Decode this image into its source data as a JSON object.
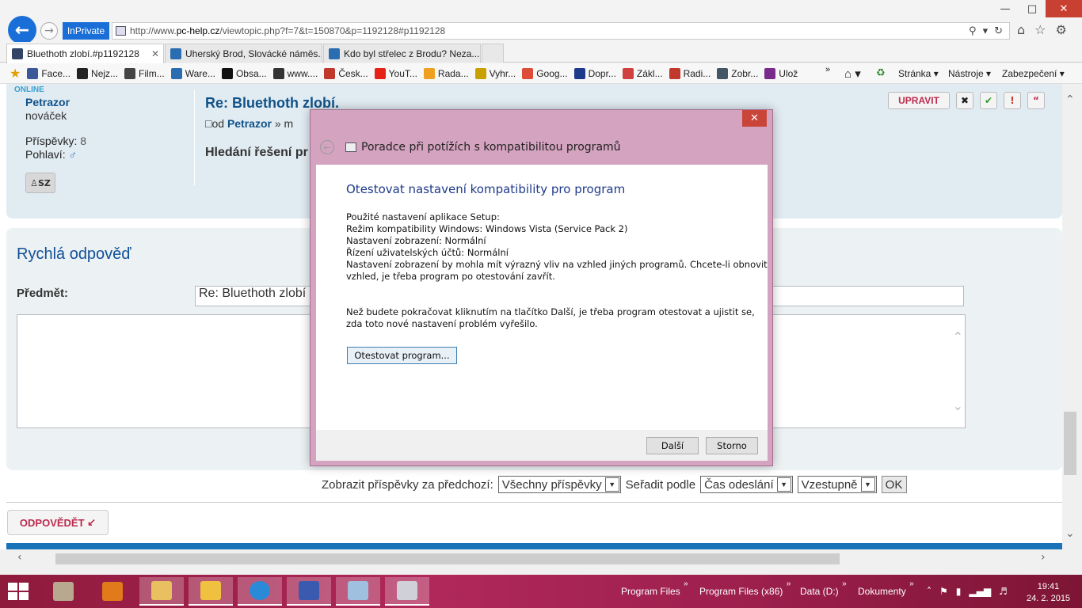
{
  "browser": {
    "inprivate_label": "InPrivate",
    "url_prefix": "http://www.",
    "url_domain": "pc-help.cz",
    "url_path": "/viewtopic.php?f=7&t=150870&p=1192128#p1192128",
    "tabs": [
      {
        "label": "Bluethoth zlobí.#p1192128",
        "icon_color": "#334466"
      },
      {
        "label": "Uherský Brod, Slovácké náměs...",
        "icon_color": "#2a6db0"
      },
      {
        "label": "Kdo byl střelec z Brodu? Neza...",
        "icon_color": "#2a6db0"
      }
    ],
    "favorites": [
      {
        "label": "Face...",
        "icon_color": "#3b5998"
      },
      {
        "label": "Nejz...",
        "icon_color": "#222222"
      },
      {
        "label": "Film...",
        "icon_color": "#444444"
      },
      {
        "label": "Ware...",
        "icon_color": "#2a6db0"
      },
      {
        "label": "Obsa...",
        "icon_color": "#111111"
      },
      {
        "label": "www....",
        "icon_color": "#333333"
      },
      {
        "label": "Česk...",
        "icon_color": "#c0392b"
      },
      {
        "label": "YouT...",
        "icon_color": "#e62117"
      },
      {
        "label": "Rada...",
        "icon_color": "#f0a020"
      },
      {
        "label": "Vyhr...",
        "icon_color": "#c8a000"
      },
      {
        "label": "Goog...",
        "icon_color": "#dd4b39"
      },
      {
        "label": "Dopr...",
        "icon_color": "#1e3a8a"
      },
      {
        "label": "Zákl...",
        "icon_color": "#d04040"
      },
      {
        "label": "Radi...",
        "icon_color": "#c0392b"
      },
      {
        "label": "Zobr...",
        "icon_color": "#445566"
      },
      {
        "label": "Ulož",
        "icon_color": "#7a2c8a"
      }
    ],
    "command_menus": {
      "page": "Stránka",
      "tools": "Nástroje",
      "security": "Zabezpečení"
    }
  },
  "post": {
    "online_label": "ONLINE",
    "author": "Petrazor",
    "rank": "nováček",
    "posts_label": "Příspěvky:",
    "posts_value": "8",
    "gender_label": "Pohlaví:",
    "sz_label": "SZ",
    "title": "Re: Bluethoth zlobí.",
    "by_prefix": "od",
    "by_author": "Petrazor",
    "by_suffix": "» m",
    "body_start": "Hledání řešení pr",
    "edit_label": "UPRAVIT"
  },
  "quick_reply": {
    "title": "Rychlá odpověď",
    "subject_label": "Předmět:",
    "subject_value": "Re: Bluethoth zlobí"
  },
  "sort": {
    "show_label": "Zobrazit příspěvky za předchozí:",
    "show_value": "Všechny příspěvky",
    "sort_label": "Seřadit podle",
    "sort_value": "Čas odeslání",
    "order_value": "Vzestupně",
    "ok_label": "OK"
  },
  "reply_button": "ODPOVĚDĚT",
  "dialog": {
    "title": "Poradce při potížích s kompatibilitou programů",
    "heading": "Otestovat nastavení kompatibility pro program",
    "lines": [
      "Použité nastavení aplikace  Setup:",
      "Režim kompatibility Windows: Windows Vista (Service Pack 2)",
      "Nastavení zobrazení:  Normální",
      "Řízení uživatelských účtů:  Normální",
      "Nastavení zobrazení by mohla mít výrazný vliv na vzhled jiných programů. Chcete-li obnovit",
      "vzhled, je třeba program po otestování zavřít."
    ],
    "note": "Než budete pokračovat kliknutím na tlačítko Další, je třeba program otestovat a ujistit se, zda toto nové nastavení problém vyřešilo.",
    "test_button": "Otestovat program...",
    "next_button": "Další",
    "cancel_button": "Storno"
  },
  "taskbar": {
    "toolbar_links": [
      "Program Files",
      "Program Files (x86)",
      "Data (D:)",
      "Dokumenty"
    ],
    "time": "19:41",
    "date": "24. 2. 2015"
  }
}
